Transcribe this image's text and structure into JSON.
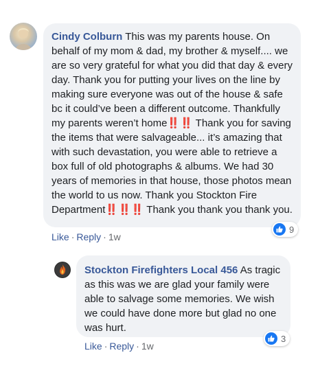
{
  "comments": [
    {
      "author": "Cindy Colburn",
      "text": "This was my parents house. On behalf of my mom & dad, my brother & myself.... we are so very grateful for what you did that day & every day. Thank you for putting your lives on the line by making sure everyone was out of the house & safe bc it could’ve been a different outcome. Thankfully my parents weren’t home‼️‼️ Thank you for saving the items that were salvageable... it’s amazing that with such devastation, you were able to retrieve a box full of old photographs & albums. We had 30 years of memories in that house, those photos mean the world to us now. Thank you Stockton Fire Department‼️‼️‼️ Thank you thank you thank you.",
      "reaction_count": "9",
      "like_label": "Like",
      "reply_label": "Reply",
      "time": "1w"
    },
    {
      "author": "Stockton Firefighters Local 456",
      "text": "As tragic as this was we are glad your family were able to salvage some memories. We wish we could have done more but glad no one was hurt.",
      "reaction_count": "3",
      "like_label": "Like",
      "reply_label": "Reply",
      "time": "1w"
    }
  ],
  "separator": "·",
  "colors": {
    "author": "#385898",
    "bubble": "#f0f2f5",
    "like_blue": "#1877f2",
    "meta_gray": "#65676b"
  }
}
